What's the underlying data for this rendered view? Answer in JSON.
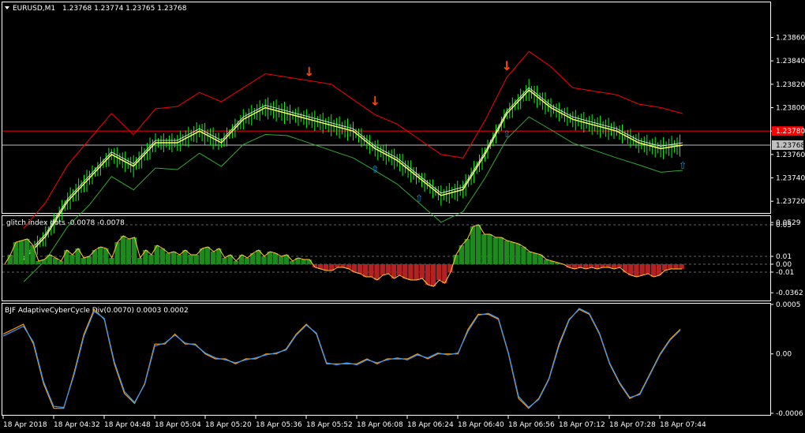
{
  "window": {
    "symbol_title": "EURUSD,M1",
    "ohlc": "1.23768 1.23774 1.23765 1.23768"
  },
  "colors": {
    "background": "#000000",
    "frame": "#ffffff",
    "bull_histogram": "#1e8a1e",
    "bear_histogram": "#b22222",
    "arrow_down": "#ff4500",
    "arrow_up": "#00a2e8",
    "marker_magenta": "#ff00ff",
    "hline_red": "#ff0000",
    "hline_grey": "#c0c0c0",
    "price_bar": "#00ff00",
    "channel_red": "#ff0000",
    "ma_yellow": "#ffff66",
    "cycle_orange": "#ff9900",
    "cycle_blue": "#3399ff"
  },
  "chart_data": [
    {
      "type": "line",
      "panel": "main",
      "ylim": [
        1.2371,
        1.2389
      ],
      "yticks": [
        "1.23860",
        "1.23840",
        "1.23820",
        "1.23800",
        "1.23780",
        "1.23760",
        "1.23740",
        "1.23720"
      ],
      "ytick_values": [
        1.2386,
        1.2384,
        1.2382,
        1.238,
        1.2378,
        1.2376,
        1.2374,
        1.2372
      ],
      "hlines": [
        {
          "value": 1.2378,
          "label": "1.23780",
          "color": "#ff0000"
        },
        {
          "value": 1.23768,
          "label": "1.23768",
          "color": "#c0c0c0"
        }
      ],
      "price_series_x": [
        0,
        4,
        8,
        12,
        16,
        20,
        24,
        28,
        32,
        36,
        40,
        44,
        48,
        52,
        56,
        60,
        64,
        68,
        72,
        76,
        80,
        84,
        88,
        92,
        96,
        100,
        104,
        108,
        112,
        116,
        120
      ],
      "price_series": [
        1.2367,
        1.2369,
        1.2372,
        1.2374,
        1.2376,
        1.2375,
        1.2377,
        1.2377,
        1.2378,
        1.2377,
        1.2379,
        1.238,
        1.23795,
        1.2379,
        1.23785,
        1.2378,
        1.23765,
        1.23755,
        1.2374,
        1.23725,
        1.2373,
        1.2376,
        1.23795,
        1.23815,
        1.238,
        1.2379,
        1.23785,
        1.2378,
        1.2377,
        1.23765,
        1.23768
      ],
      "arrows_down_x": [
        53,
        62,
        88,
        89
      ],
      "arrows_up_x": [
        63,
        72,
        88,
        121
      ]
    },
    {
      "type": "bar",
      "panel": "glitch",
      "title": "glitch index dots -0.0078 -0.0078",
      "ylim": [
        -0.045,
        0.06
      ],
      "yticks": [
        "0.0529",
        "0.05",
        "0.01",
        "0.00",
        "-0.01",
        "-0.0362"
      ],
      "ytick_values": [
        0.0529,
        0.05,
        0.01,
        0.0,
        -0.01,
        -0.0362
      ],
      "values": [
        0.0,
        0.012,
        0.028,
        0.03,
        0.032,
        0.024,
        0.004,
        0.006,
        0.012,
        0.008,
        0.004,
        0.018,
        0.012,
        0.02,
        0.008,
        0.01,
        0.018,
        0.022,
        0.02,
        0.008,
        0.028,
        0.036,
        0.032,
        0.034,
        0.008,
        0.018,
        0.012,
        0.024,
        0.02,
        0.014,
        0.016,
        0.012,
        0.018,
        0.012,
        0.012,
        0.02,
        0.022,
        0.016,
        0.02,
        0.008,
        0.012,
        0.004,
        0.012,
        0.008,
        0.014,
        0.018,
        0.01,
        0.016,
        0.014,
        0.01,
        0.012,
        0.004,
        0.008,
        0.006,
        0.006,
        -0.004,
        -0.006,
        -0.008,
        -0.008,
        -0.004,
        -0.004,
        -0.006,
        -0.01,
        -0.012,
        -0.016,
        -0.016,
        -0.02,
        -0.014,
        -0.012,
        -0.018,
        -0.014,
        -0.018,
        -0.02,
        -0.02,
        -0.018,
        -0.026,
        -0.028,
        -0.02,
        -0.024,
        -0.01,
        0.012,
        0.024,
        0.032,
        0.048,
        0.05,
        0.038,
        0.038,
        0.034,
        0.034,
        0.03,
        0.028,
        0.026,
        0.022,
        0.016,
        0.014,
        0.012,
        0.006,
        0.004,
        0.002,
        0.0,
        -0.004,
        -0.006,
        -0.004,
        -0.006,
        -0.004,
        -0.006,
        -0.004,
        -0.004,
        -0.006,
        -0.004,
        -0.01,
        -0.014,
        -0.016,
        -0.014,
        -0.012,
        -0.016,
        -0.014,
        -0.008,
        -0.006,
        -0.006,
        -0.006
      ]
    },
    {
      "type": "line",
      "panel": "cycle",
      "title": "BJF AdaptiveCyberCycle Div(0.0070) 0.0003 0.0002",
      "ylim": [
        -0.0006,
        0.0005
      ],
      "yticks": [
        "0.0005",
        "0.00",
        "-0.0006"
      ],
      "ytick_values": [
        0.0005,
        0.0,
        -0.0006
      ],
      "series": [
        {
          "color": "#ff9900",
          "values": [
            0.0002,
            0.00025,
            0.0003,
            0.0001,
            -0.0003,
            -0.00055,
            -0.00055,
            -0.0002,
            0.0002,
            0.00045,
            0.00035,
            -0.0001,
            -0.0004,
            -0.0005,
            -0.0003,
            0.0001,
            0.0001,
            0.0002,
            0.0001,
            0.0001,
            0.0,
            -5e-05,
            -5e-05,
            -0.0001,
            -5e-05,
            -5e-05,
            0.0,
            0.0,
            5e-05,
            0.0002,
            0.0003,
            0.0002,
            -0.0001,
            -0.0001,
            -0.0001,
            -0.0001,
            -5e-05,
            -0.0001,
            -5e-05,
            -5e-05,
            -5e-05,
            -0.0,
            -5e-05,
            0.0,
            0.0,
            0.0,
            0.00025,
            0.0004,
            0.0004,
            0.00035,
            0.0,
            -0.00045,
            -0.00055,
            -0.00045,
            -0.00025,
            0.0001,
            0.00035,
            0.00045,
            0.0004,
            0.0002,
            -0.0001,
            -0.0003,
            -0.00045,
            -0.0004,
            -0.0002,
            0.0,
            0.00015,
            0.00025
          ]
        },
        {
          "color": "#3399ff",
          "values": [
            0.00018,
            0.00023,
            0.00028,
            0.00012,
            -0.00028,
            -0.00053,
            -0.00054,
            -0.00022,
            0.00018,
            0.00043,
            0.00036,
            -8e-05,
            -0.00038,
            -0.00049,
            -0.00031,
            8e-05,
            0.00011,
            0.00019,
            0.00011,
            9e-05,
            1e-05,
            -4e-05,
            -6e-05,
            -9e-05,
            -6e-05,
            -4e-05,
            -1e-05,
            1e-05,
            4e-05,
            0.00019,
            0.00029,
            0.00021,
            -9e-05,
            -0.00011,
            -9e-05,
            -0.00011,
            -6e-05,
            -9e-05,
            -6e-05,
            -4e-05,
            -6e-05,
            -1e-05,
            -4e-05,
            1e-05,
            -1e-05,
            1e-05,
            0.00023,
            0.00039,
            0.00041,
            0.00036,
            1e-05,
            -0.00043,
            -0.00054,
            -0.00046,
            -0.00026,
            8e-05,
            0.00034,
            0.00046,
            0.00041,
            0.00021,
            -9e-05,
            -0.00029,
            -0.00044,
            -0.00041,
            -0.00021,
            -1e-05,
            0.00014,
            0.00024
          ]
        }
      ]
    }
  ],
  "xaxis": {
    "labels": [
      "18 Apr 2018",
      "18 Apr 04:32",
      "18 Apr 04:48",
      "18 Apr 05:04",
      "18 Apr 05:20",
      "18 Apr 05:36",
      "18 Apr 05:52",
      "18 Apr 06:08",
      "18 Apr 06:24",
      "18 Apr 06:40",
      "18 Apr 06:56",
      "18 Apr 07:12",
      "18 Apr 07:28",
      "18 Apr 07:44"
    ]
  }
}
